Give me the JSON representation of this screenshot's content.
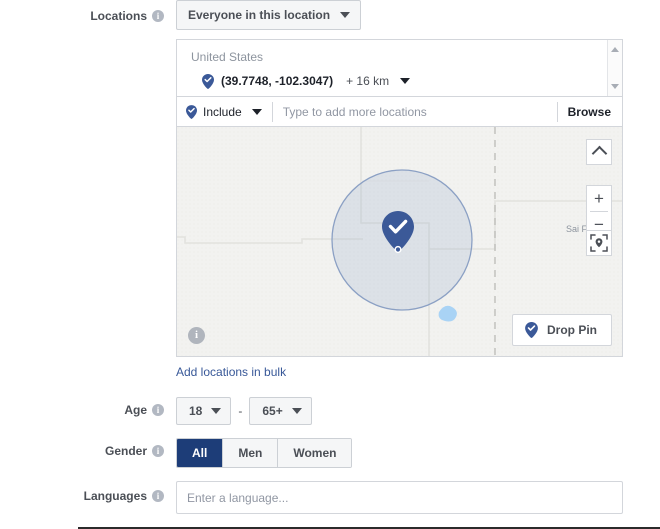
{
  "locations": {
    "label": "Locations",
    "info_icon": "info-icon",
    "scope_dropdown": {
      "value": "Everyone in this location",
      "caret_icon": "chevron-down-icon"
    },
    "selected": {
      "country": "United States",
      "pin_icon": "map-pin-check-icon",
      "coordinates": "(39.7748, -102.3047)",
      "radius": "+ 16 km",
      "radius_caret_icon": "chevron-down-icon"
    },
    "scrollbar": {
      "up_icon": "scroll-up-arrow-icon",
      "down_icon": "scroll-down-arrow-icon"
    },
    "include_bar": {
      "mode_icon": "map-pin-check-icon",
      "mode": "Include",
      "mode_caret_icon": "chevron-down-icon",
      "search_placeholder": "Type to add more locations",
      "search_value": "",
      "browse": "Browse"
    },
    "map": {
      "city_label": "Sai Fran",
      "collapse_icon": "chevron-up-icon",
      "zoom_in": "+",
      "zoom_out": "−",
      "locate_icon": "locate-pin-icon",
      "info_icon": "info-icon",
      "drop_pin": {
        "label": "Drop Pin",
        "icon": "map-pin-check-icon"
      }
    },
    "bulk_link": "Add locations in bulk"
  },
  "age": {
    "label": "Age",
    "info_icon": "info-icon",
    "min": "18",
    "max": "65+",
    "separator": "-",
    "caret_icon": "chevron-down-icon"
  },
  "gender": {
    "label": "Gender",
    "info_icon": "info-icon",
    "options": [
      "All",
      "Men",
      "Women"
    ],
    "selected": "All"
  },
  "languages": {
    "label": "Languages",
    "info_icon": "info-icon",
    "placeholder": "Enter a language...",
    "value": ""
  },
  "colors": {
    "accent_blue": "#3b5998",
    "link_blue": "#385898",
    "selected_navy": "#1d3d78",
    "map_bg": "#f2f2f0",
    "border": "#d3d6db"
  }
}
